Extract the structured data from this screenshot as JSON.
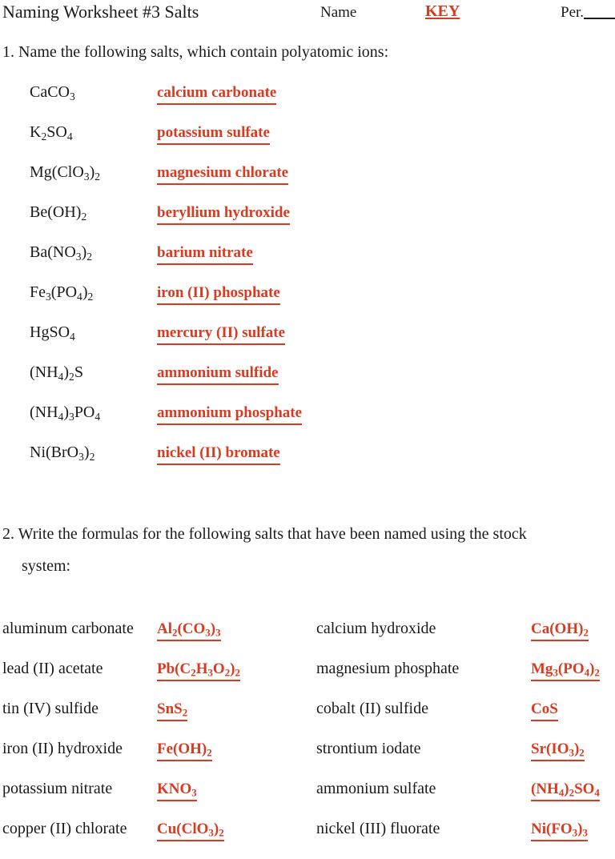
{
  "header": {
    "title": "Naming Worksheet #3 Salts",
    "name_label": "Name",
    "key_label": "KEY",
    "period_label": "Per."
  },
  "accent_color": "#D93A20",
  "question1": {
    "prompt": "1. Name the following salts, which contain polyatomic ions:",
    "rows": [
      {
        "formula": "CaCO3",
        "formula_html": "CaCO<sub>3</sub>",
        "answer": "calcium carbonate"
      },
      {
        "formula": "K2SO4",
        "formula_html": "K<sub>2</sub>SO<sub>4</sub>",
        "answer": "potassium sulfate"
      },
      {
        "formula": "Mg(ClO3)2",
        "formula_html": "Mg(ClO<sub>3</sub>)<sub>2</sub>",
        "answer": "magnesium chlorate"
      },
      {
        "formula": "Be(OH)2",
        "formula_html": "Be(OH)<sub>2</sub>",
        "answer": "beryllium hydroxide"
      },
      {
        "formula": "Ba(NO3)2",
        "formula_html": "Ba(NO<sub>3</sub>)<sub>2</sub>",
        "answer": "barium nitrate"
      },
      {
        "formula": "Fe3(PO4)2",
        "formula_html": "Fe<sub>3</sub>(PO<sub>4</sub>)<sub>2</sub>",
        "answer": "iron (II) phosphate"
      },
      {
        "formula": "HgSO4",
        "formula_html": "HgSO<sub>4</sub>",
        "answer": "mercury (II) sulfate"
      },
      {
        "formula": "(NH4)2S",
        "formula_html": "(NH<sub>4</sub>)<sub>2</sub>S",
        "answer": "ammonium sulfide"
      },
      {
        "formula": "(NH4)3PO4",
        "formula_html": "(NH<sub>4</sub>)<sub>3</sub>PO<sub>4</sub>",
        "answer": "ammonium phosphate"
      },
      {
        "formula": "Ni(BrO3)2",
        "formula_html": "Ni(BrO<sub>3</sub>)<sub>2</sub>",
        "answer": "nickel (II) bromate"
      }
    ]
  },
  "question2": {
    "prompt_line1": "2.  Write the formulas for the following salts that have been named using the stock",
    "prompt_line2": "system:",
    "rows": [
      {
        "left_name": "aluminum carbonate",
        "left_answer": "Al2(CO3)3",
        "left_answer_html": "Al<sub>2</sub>(CO<sub>3</sub>)<sub>3</sub>",
        "right_name": "calcium hydroxide",
        "right_answer": "Ca(OH)2",
        "right_answer_html": "Ca(OH)<sub>2</sub>"
      },
      {
        "left_name": "lead (II) acetate",
        "left_answer": "Pb(C2H3O2)2",
        "left_answer_html": "Pb(C<sub>2</sub>H<sub>3</sub>O<sub>2</sub>)<sub>2</sub>",
        "right_name": "magnesium phosphate",
        "right_answer": "Mg3(PO4)2",
        "right_answer_html": "Mg<sub>3</sub>(PO<sub>4</sub>)<sub>2</sub>"
      },
      {
        "left_name": "tin (IV) sulfide",
        "left_answer": "SnS2",
        "left_answer_html": "SnS<sub>2</sub>",
        "right_name": "cobalt (II) sulfide",
        "right_answer": "CoS",
        "right_answer_html": "CoS"
      },
      {
        "left_name": "iron (II) hydroxide",
        "left_answer": "Fe(OH)2",
        "left_answer_html": "Fe(OH)<sub>2</sub>",
        "right_name": "strontium iodate",
        "right_answer": "Sr(IO3)2",
        "right_answer_html": "Sr(IO<sub>3</sub>)<sub>2</sub>"
      },
      {
        "left_name": "potassium nitrate",
        "left_answer": "KNO3",
        "left_answer_html": "KNO<sub>3</sub>",
        "right_name": "ammonium sulfate",
        "right_answer": "(NH4)2SO4",
        "right_answer_html": "(NH<sub>4</sub>)<sub>2</sub>SO<sub>4</sub>"
      },
      {
        "left_name": "copper (II) chlorate",
        "left_answer": "Cu(ClO3)2",
        "left_answer_html": "Cu(ClO<sub>3</sub>)<sub>2</sub>",
        "right_name": "nickel (III) fluorate",
        "right_answer": "Ni(FO3)3",
        "right_answer_html": "Ni(FO<sub>3</sub>)<sub>3</sub>"
      }
    ]
  }
}
